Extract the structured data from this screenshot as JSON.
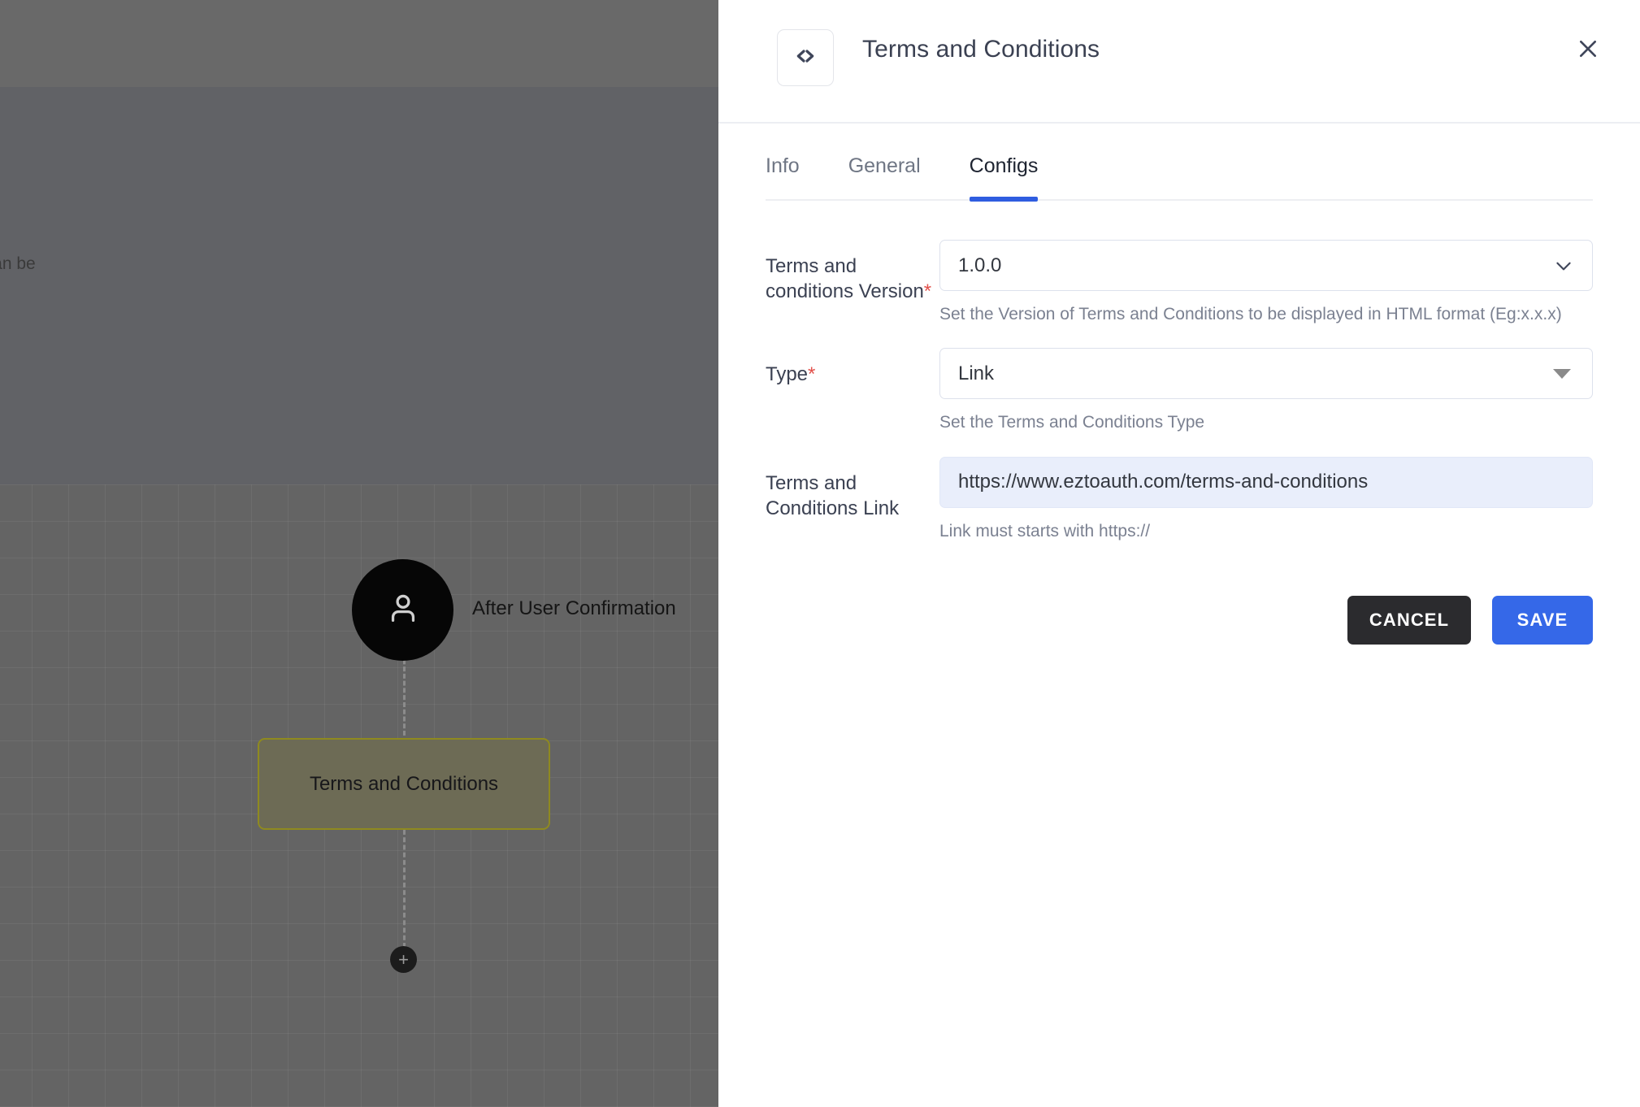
{
  "background": {
    "clipped_text": "er. It can be",
    "nodes": {
      "user_node_label": "After User Confirmation",
      "terms_node_label": "Terms and Conditions",
      "add_node_glyph": "+"
    },
    "icons": {
      "user": "user-icon",
      "add": "plus-icon"
    }
  },
  "panel": {
    "header": {
      "icon": "code-brackets-icon",
      "title": "Terms and Conditions",
      "close_icon": "close-icon"
    },
    "tabs": [
      {
        "label": "Info",
        "active": false
      },
      {
        "label": "General",
        "active": false
      },
      {
        "label": "Configs",
        "active": true
      }
    ],
    "fields": [
      {
        "label": "Terms and conditions Version",
        "required": true,
        "control": "select",
        "value": "1.0.0",
        "icon": "chevron-down-icon",
        "helper": "Set the Version of Terms and Conditions to be displayed in HTML format (Eg:x.x.x)"
      },
      {
        "label": "Type",
        "required": true,
        "control": "select",
        "value": "Link",
        "icon": "caret-down-icon",
        "helper": "Set the Terms and Conditions Type"
      },
      {
        "label": "Terms and Conditions Link",
        "required": false,
        "control": "text",
        "value": "https://www.eztoauth.com/terms-and-conditions",
        "helper": "Link must starts with https://"
      }
    ],
    "actions": {
      "cancel_label": "CANCEL",
      "save_label": "SAVE"
    }
  },
  "colors": {
    "accent_blue": "#3568e8",
    "tab_underline": "#2f5de0",
    "required_star": "#e2504a",
    "cancel_dark": "#2b2b2e",
    "filled_input_bg": "#e9eefb",
    "node_fill": "#6d6b55",
    "node_border": "#8f8a1f"
  }
}
